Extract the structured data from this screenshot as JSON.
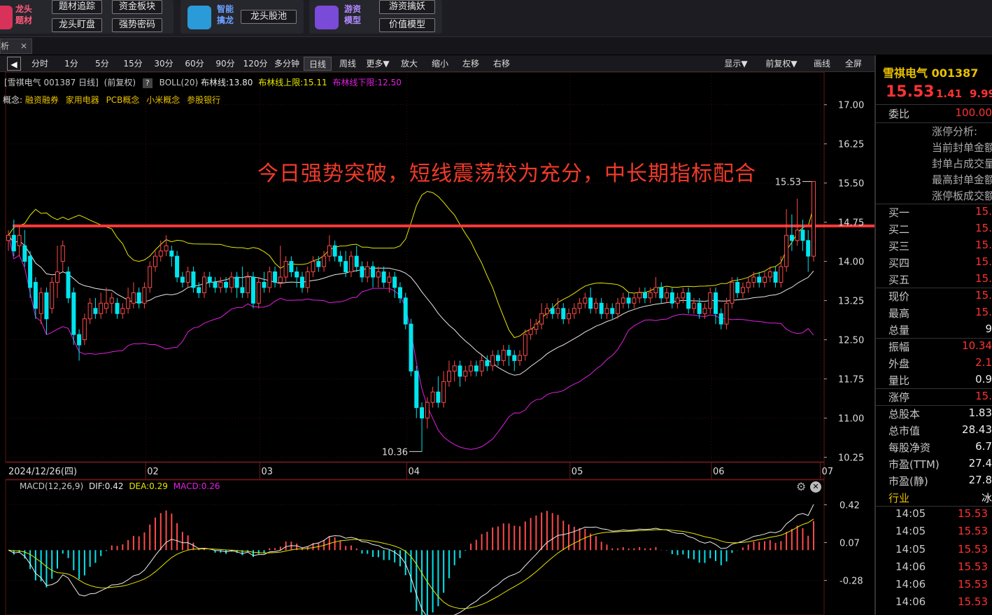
{
  "topbar": {
    "group1": {
      "label": "龙头\n题材",
      "buttons": [
        "题材追踪",
        "资金板块",
        "龙头盯盘",
        "强势密码"
      ]
    },
    "group2": {
      "label": "智能\n擒龙",
      "buttons": [
        "龙头股池"
      ]
    },
    "group3": {
      "label": "游资\n模型",
      "buttons": [
        "游资擒妖",
        "价值模型"
      ]
    }
  },
  "tabbar": {
    "tab_label": "析",
    "close_glyph": "✕"
  },
  "toolbar": {
    "periods": [
      "分时",
      "1分",
      "5分",
      "15分",
      "30分",
      "60分",
      "90分",
      "120分",
      "多分钟",
      "日线",
      "周线",
      "更多▼"
    ],
    "actions": [
      "放大",
      "缩小",
      "左移",
      "右移"
    ],
    "right_actions": [
      "显示▼",
      "前复权▼",
      "画线",
      "全屏"
    ],
    "active": "日线"
  },
  "chart_header": {
    "stock": "[雪祺电气 001387 日线]",
    "adj": "(前复权)",
    "help": "?",
    "boll": "BOLL(20)",
    "mid": "布林线:13.80",
    "upper": "布林线上限:15.11",
    "lower": "布林线下限:12.50"
  },
  "concepts": {
    "prefix": "概念:",
    "items": [
      "融资融券",
      "家用电器",
      "PCB概念",
      "小米概念",
      "参股银行"
    ]
  },
  "annotation": "今日强势突破，短线震荡较为充分，中长期指标配合",
  "macd_header": {
    "name": "MACD(12,26,9)",
    "dif": "DIF:0.42",
    "dea": "DEA:0.29",
    "macd": "MACD:0.26"
  },
  "colors": {
    "up": "#ff4a4a",
    "down": "#00e5ee",
    "mid": "#e8e8e8",
    "upper": "#e6e600",
    "lower": "#e020e0",
    "line": "#ff3a3a",
    "accent": "#e8c000"
  },
  "chart_data": [
    {
      "type": "candlestick",
      "title": "[雪祺电气 001387 日线]",
      "x_axis_labels": [
        "2024/12/26(四)",
        "02",
        "03",
        "04",
        "05",
        "06",
        "07"
      ],
      "y_ticks": [
        17.0,
        16.25,
        15.5,
        14.75,
        14.0,
        13.25,
        12.5,
        11.75,
        11.0,
        10.25
      ],
      "ylim": [
        10.15,
        17.25
      ],
      "high_label": "15.53",
      "low_label": "10.36",
      "horizontal_line": 14.68,
      "indicators": [
        {
          "name": "布林线",
          "value": 13.8
        },
        {
          "name": "布林线上限",
          "value": 15.11
        },
        {
          "name": "布林线下限",
          "value": 12.5
        }
      ],
      "candles": [
        [
          14.4,
          14.5,
          14.6,
          14.2
        ],
        [
          14.5,
          14.2,
          14.8,
          14.1
        ],
        [
          14.3,
          14.5,
          14.7,
          14.1
        ],
        [
          14.3,
          14.0,
          14.6,
          13.9
        ],
        [
          14.1,
          13.5,
          14.2,
          13.3
        ],
        [
          13.6,
          13.1,
          13.7,
          12.9
        ],
        [
          13.0,
          13.4,
          13.5,
          12.8
        ],
        [
          13.4,
          12.9,
          13.5,
          12.6
        ],
        [
          13.1,
          13.6,
          13.7,
          13.0
        ],
        [
          13.6,
          13.8,
          14.3,
          13.3
        ],
        [
          14.0,
          14.3,
          14.4,
          13.8
        ],
        [
          13.8,
          13.3,
          13.9,
          13.2
        ],
        [
          13.4,
          12.6,
          13.5,
          12.4
        ],
        [
          12.6,
          12.4,
          12.7,
          12.1
        ],
        [
          12.5,
          12.9,
          13.0,
          12.4
        ],
        [
          12.9,
          13.2,
          13.3,
          12.8
        ],
        [
          13.1,
          13.0,
          13.3,
          12.9
        ],
        [
          13.0,
          13.2,
          13.4,
          12.9
        ],
        [
          13.1,
          13.2,
          13.5,
          13.0
        ],
        [
          13.2,
          13.3,
          13.4,
          13.0
        ],
        [
          13.2,
          13.0,
          13.3,
          12.9
        ],
        [
          13.0,
          13.1,
          13.2,
          12.9
        ],
        [
          13.1,
          13.3,
          13.5,
          13.0
        ],
        [
          13.2,
          13.4,
          13.6,
          13.1
        ],
        [
          13.4,
          13.2,
          13.5,
          13.1
        ],
        [
          13.2,
          13.5,
          13.6,
          13.1
        ],
        [
          13.5,
          13.9,
          14.0,
          13.4
        ],
        [
          13.9,
          14.1,
          14.2,
          13.8
        ],
        [
          14.1,
          14.2,
          14.4,
          14.0
        ],
        [
          14.2,
          14.3,
          14.5,
          14.1
        ],
        [
          14.2,
          14.1,
          14.3,
          13.9
        ],
        [
          14.1,
          13.7,
          14.2,
          13.6
        ],
        [
          13.7,
          13.6,
          13.8,
          13.5
        ],
        [
          13.6,
          13.8,
          13.9,
          13.5
        ],
        [
          13.8,
          13.5,
          13.9,
          13.4
        ],
        [
          13.5,
          13.4,
          13.6,
          13.3
        ],
        [
          13.4,
          13.7,
          13.8,
          13.3
        ],
        [
          13.7,
          13.6,
          13.8,
          13.5
        ],
        [
          13.6,
          13.5,
          13.7,
          13.4
        ],
        [
          13.5,
          13.6,
          13.7,
          13.4
        ],
        [
          13.6,
          13.5,
          13.7,
          13.4
        ],
        [
          13.5,
          13.7,
          13.8,
          13.4
        ],
        [
          13.7,
          13.5,
          13.8,
          13.3
        ],
        [
          13.5,
          13.4,
          13.9,
          13.3
        ],
        [
          13.4,
          13.7,
          13.8,
          13.3
        ],
        [
          13.7,
          13.2,
          13.8,
          13.1
        ],
        [
          13.2,
          13.6,
          13.7,
          13.1
        ],
        [
          13.6,
          13.5,
          13.8,
          13.4
        ],
        [
          13.5,
          13.8,
          13.9,
          13.4
        ],
        [
          13.8,
          13.6,
          13.9,
          13.5
        ],
        [
          13.6,
          13.7,
          14.3,
          13.5
        ],
        [
          13.7,
          14.0,
          14.1,
          13.6
        ],
        [
          14.0,
          13.8,
          14.1,
          13.7
        ],
        [
          13.8,
          13.7,
          13.9,
          13.5
        ],
        [
          13.7,
          13.5,
          13.8,
          13.4
        ],
        [
          13.5,
          13.8,
          13.9,
          13.4
        ],
        [
          13.8,
          14.0,
          14.1,
          13.7
        ],
        [
          14.0,
          13.9,
          14.1,
          13.8
        ],
        [
          13.9,
          14.1,
          14.2,
          13.8
        ],
        [
          14.1,
          14.3,
          14.5,
          14.0
        ],
        [
          14.3,
          14.1,
          14.4,
          14.0
        ],
        [
          14.1,
          14.0,
          14.2,
          13.9
        ],
        [
          14.0,
          13.8,
          14.2,
          13.7
        ],
        [
          13.8,
          14.1,
          14.2,
          13.7
        ],
        [
          14.1,
          13.9,
          14.3,
          13.8
        ],
        [
          13.9,
          13.7,
          14.0,
          13.6
        ],
        [
          13.7,
          13.9,
          14.0,
          13.6
        ],
        [
          13.9,
          13.7,
          14.0,
          13.5
        ],
        [
          13.7,
          13.8,
          13.9,
          13.5
        ],
        [
          13.8,
          13.6,
          13.9,
          13.5
        ],
        [
          13.6,
          13.7,
          13.8,
          13.4
        ],
        [
          13.7,
          13.5,
          13.8,
          13.3
        ],
        [
          13.5,
          13.3,
          13.6,
          13.2
        ],
        [
          13.3,
          12.8,
          13.4,
          12.7
        ],
        [
          12.8,
          11.9,
          12.9,
          11.8
        ],
        [
          11.9,
          11.2,
          12.0,
          11.0
        ],
        [
          11.2,
          11.0,
          11.3,
          10.36
        ],
        [
          11.0,
          11.3,
          11.4,
          10.8
        ],
        [
          11.3,
          11.5,
          11.6,
          11.2
        ],
        [
          11.5,
          11.3,
          11.8,
          11.2
        ],
        [
          11.3,
          11.7,
          11.9,
          11.2
        ],
        [
          11.7,
          11.9,
          12.1,
          11.6
        ],
        [
          11.9,
          12.0,
          12.1,
          11.7
        ],
        [
          12.0,
          11.8,
          12.1,
          11.6
        ],
        [
          11.8,
          11.9,
          12.0,
          11.7
        ],
        [
          11.9,
          12.0,
          12.1,
          11.8
        ],
        [
          12.0,
          11.9,
          12.1,
          11.8
        ],
        [
          11.9,
          12.1,
          12.2,
          11.8
        ],
        [
          12.1,
          12.0,
          12.2,
          11.9
        ],
        [
          12.0,
          12.2,
          12.3,
          11.9
        ],
        [
          12.2,
          12.1,
          12.3,
          12.0
        ],
        [
          12.1,
          12.3,
          12.4,
          12.0
        ],
        [
          12.3,
          12.2,
          12.4,
          12.0
        ],
        [
          12.2,
          12.1,
          12.3,
          11.9
        ],
        [
          12.1,
          12.2,
          12.3,
          12.0
        ],
        [
          12.2,
          12.6,
          12.7,
          12.1
        ],
        [
          12.6,
          12.7,
          12.9,
          12.5
        ],
        [
          12.7,
          12.8,
          12.9,
          12.6
        ],
        [
          12.8,
          13.0,
          13.2,
          12.7
        ],
        [
          13.0,
          13.1,
          13.2,
          12.9
        ],
        [
          13.1,
          13.0,
          13.2,
          12.9
        ],
        [
          13.0,
          13.1,
          13.3,
          12.9
        ],
        [
          13.1,
          12.9,
          13.2,
          12.8
        ],
        [
          12.9,
          13.0,
          13.1,
          12.8
        ],
        [
          13.0,
          13.1,
          13.2,
          12.9
        ],
        [
          13.1,
          13.2,
          13.3,
          13.0
        ],
        [
          13.2,
          13.3,
          13.4,
          13.1
        ],
        [
          13.3,
          13.1,
          13.5,
          13.0
        ],
        [
          13.1,
          13.2,
          13.3,
          13.0
        ],
        [
          13.2,
          13.0,
          13.3,
          12.9
        ],
        [
          13.0,
          13.1,
          13.2,
          12.9
        ],
        [
          13.1,
          13.0,
          13.2,
          12.9
        ],
        [
          13.0,
          13.2,
          13.3,
          12.9
        ],
        [
          13.2,
          13.3,
          13.4,
          13.1
        ],
        [
          13.3,
          13.2,
          13.4,
          13.1
        ],
        [
          13.2,
          13.3,
          13.4,
          13.1
        ],
        [
          13.3,
          13.4,
          13.5,
          13.2
        ],
        [
          13.4,
          13.3,
          13.5,
          13.2
        ],
        [
          13.3,
          13.4,
          13.5,
          13.2
        ],
        [
          13.4,
          13.5,
          13.7,
          13.3
        ],
        [
          13.5,
          13.3,
          13.6,
          13.2
        ],
        [
          13.3,
          13.4,
          13.5,
          13.2
        ],
        [
          13.4,
          13.2,
          13.5,
          13.1
        ],
        [
          13.2,
          13.3,
          13.4,
          13.1
        ],
        [
          13.3,
          13.4,
          13.5,
          13.2
        ],
        [
          13.4,
          13.1,
          13.5,
          13.0
        ],
        [
          13.1,
          13.2,
          13.3,
          13.0
        ],
        [
          13.2,
          13.0,
          13.3,
          12.9
        ],
        [
          13.0,
          13.1,
          13.2,
          12.9
        ],
        [
          13.1,
          13.4,
          13.5,
          13.0
        ],
        [
          13.4,
          13.0,
          13.5,
          12.8
        ],
        [
          13.0,
          12.8,
          13.1,
          12.7
        ],
        [
          12.8,
          13.2,
          13.3,
          12.7
        ],
        [
          13.2,
          13.6,
          13.7,
          13.1
        ],
        [
          13.6,
          13.4,
          13.7,
          13.3
        ],
        [
          13.4,
          13.5,
          13.6,
          13.3
        ],
        [
          13.5,
          13.6,
          13.7,
          13.4
        ],
        [
          13.6,
          13.7,
          13.8,
          13.5
        ],
        [
          13.7,
          13.6,
          13.8,
          13.5
        ],
        [
          13.6,
          13.7,
          13.8,
          13.5
        ],
        [
          13.7,
          13.8,
          13.9,
          13.6
        ],
        [
          13.8,
          13.6,
          13.9,
          13.5
        ],
        [
          13.6,
          13.9,
          14.1,
          13.5
        ],
        [
          13.9,
          14.5,
          15.0,
          13.8
        ],
        [
          14.5,
          14.4,
          14.9,
          14.2
        ],
        [
          14.4,
          14.6,
          15.2,
          14.3
        ],
        [
          14.6,
          14.4,
          14.8,
          14.2
        ],
        [
          14.4,
          14.1,
          14.6,
          13.8
        ],
        [
          14.1,
          15.53,
          15.53,
          14.0
        ]
      ]
    },
    {
      "type": "macd",
      "title": "MACD(12,26,9)",
      "y_ticks": [
        0.42,
        0.07,
        -0.28
      ],
      "ylim": [
        -0.6,
        0.52
      ],
      "dif": 0.42,
      "dea": 0.29,
      "macd": 0.26
    }
  ],
  "right_panel": {
    "title": "雪祺电气 001387",
    "price": "15.53",
    "change": "1.41",
    "pct": "9.99%",
    "weibi": {
      "label": "委比",
      "value": "100.00"
    },
    "limit_analysis": [
      "涨停分析:",
      "当前封单金额",
      "封单占成交量",
      "最高封单金额",
      "涨停板成交额"
    ],
    "orders": [
      {
        "label": "买一",
        "value": "15."
      },
      {
        "label": "买二",
        "value": "15."
      },
      {
        "label": "买三",
        "value": "15."
      },
      {
        "label": "买四",
        "value": "15."
      },
      {
        "label": "买五",
        "value": "15."
      }
    ],
    "quote1": [
      {
        "label": "现价",
        "value": "15."
      },
      {
        "label": "最高",
        "value": "15."
      },
      {
        "label": "总量",
        "value": "9"
      }
    ],
    "quote2": [
      {
        "label": "振幅",
        "value": "10.34"
      },
      {
        "label": "外盘",
        "value": "2.1"
      },
      {
        "label": "量比",
        "value": "0.9"
      }
    ],
    "zhangting": {
      "label": "涨停",
      "value": "15."
    },
    "fundamentals": [
      {
        "label": "总股本",
        "value": "1.83"
      },
      {
        "label": "总市值",
        "value": "28.43"
      },
      {
        "label": "每股净资",
        "value": "6.7"
      },
      {
        "label": "市盈(TTM)",
        "value": "27.4"
      },
      {
        "label": "市盈(静)",
        "value": "27.8"
      }
    ],
    "industry": {
      "label": "行业",
      "value": "冰"
    },
    "ticks": [
      {
        "time": "14:05",
        "price": "15.53"
      },
      {
        "time": "14:05",
        "price": "15.53"
      },
      {
        "time": "14:05",
        "price": "15.53"
      },
      {
        "time": "14:06",
        "price": "15.53"
      },
      {
        "time": "14:06",
        "price": "15.53"
      },
      {
        "time": "14:06",
        "price": "15.53"
      }
    ]
  }
}
